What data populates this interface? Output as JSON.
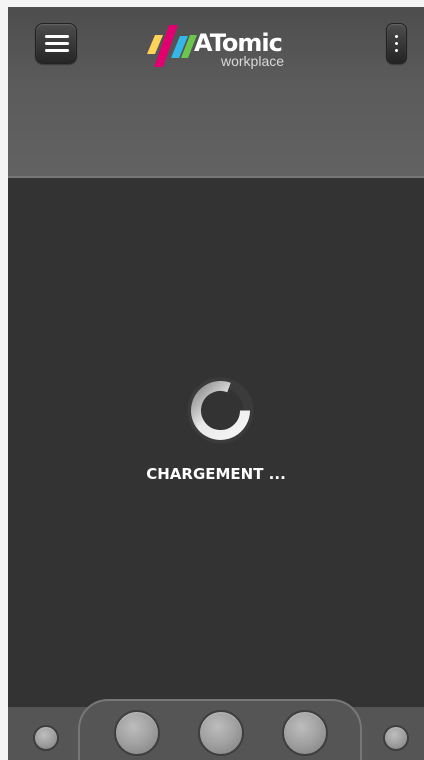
{
  "header": {
    "brand": "ATomic",
    "brand_sub": "workplace"
  },
  "icons": {
    "menu": "hamburger-icon",
    "more": "vertical-dots-icon",
    "spinner": "loading-spinner-icon",
    "bottom_navigation": [
      "small-left-circle-icon",
      "circle-icon",
      "circle-icon",
      "circle-icon",
      "small-right-circle-icon"
    ]
  },
  "main": {
    "loading_text": "CHARGEMENT ..."
  },
  "colors": {
    "header_background": "#5b5b5b",
    "content_background": "#333333",
    "bottom_bar": "#555555",
    "logo_yellow": "#ffd35a",
    "logo_magenta": "#e0006f",
    "logo_blue": "#34b7e8",
    "logo_green": "#69c74f"
  }
}
